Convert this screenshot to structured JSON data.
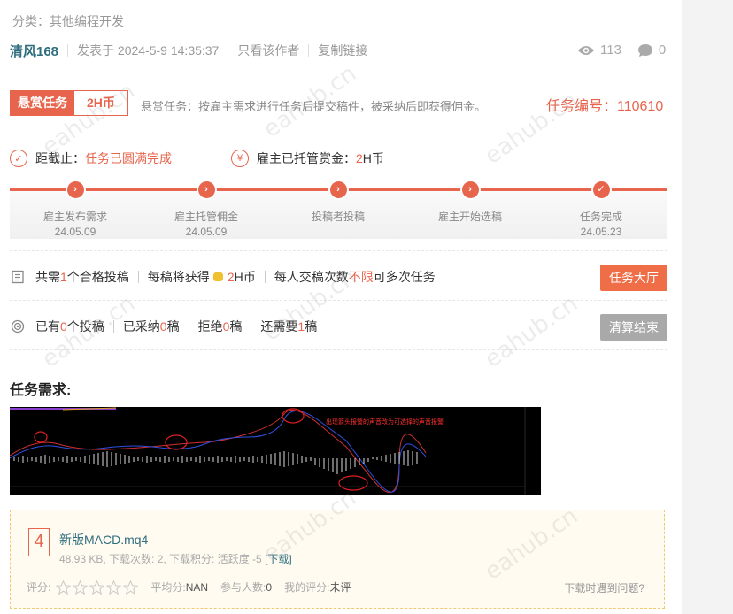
{
  "category": "分类：其他编程开发",
  "meta": {
    "author": "清风168",
    "posted": "发表于 2024-5-9 14:35:37",
    "only_author": "只看该作者",
    "copy_link": "复制链接",
    "views": "113",
    "replies": "0"
  },
  "bounty": {
    "tag": "悬赏任务",
    "amount": "2H币",
    "desc": "悬赏任务：按雇主需求进行任务后提交稿件，被采纳后即获得佣金。",
    "task_no_label": "任务编号：",
    "task_no": "110610"
  },
  "status": {
    "deadline_label": "距截止：",
    "deadline_value": "任务已圆满完成",
    "hosted_label": "雇主已托管赏金：",
    "hosted_amount": "2",
    "hosted_unit": " H币",
    "deadline_icon": "check-circle-icon",
    "hosted_icon": "yuan-icon"
  },
  "steps": [
    {
      "label": "雇主发布需求",
      "date": "24.05.09"
    },
    {
      "label": "雇主托管佣金",
      "date": "24.05.09"
    },
    {
      "label": "投稿者投稿",
      "date": ""
    },
    {
      "label": "雇主开始选稿",
      "date": ""
    },
    {
      "label": "任务完成",
      "date": "24.05.23"
    }
  ],
  "requirements": {
    "need_pre": "共需 ",
    "need_num": "1",
    "need_post": "个合格投稿",
    "earn_pre": "每稿将获得",
    "earn_num": "2",
    "earn_post": " H币",
    "times_pre": "每人交稿次数 ",
    "times_val": "不限",
    "times_post": " 可多次任务",
    "hall_button": "任务大厅"
  },
  "submissions": {
    "have_pre": "已有 ",
    "have_num": "0",
    "have_post": " 个投稿",
    "adopted_pre": "已采纳 ",
    "adopted_num": "0",
    "adopted_post": " 稿",
    "rejected_pre": "拒绝 ",
    "rejected_num": "0",
    "rejected_post": " 稿",
    "need_pre": "还需要 ",
    "need_num": "1",
    "need_post": " 稿",
    "settle_button": "清算结束"
  },
  "req_title": "任务需求:",
  "chart_annotation": "出现箭头报警的声音改为可选择的声音报警",
  "attachment": {
    "icon_digit": "4",
    "filename": "新版MACD.mq4",
    "info": "48.93 KB, 下载次数: 2, 下载积分: 活跃度 -5",
    "download": "[下载]",
    "rating_label": "评分:",
    "avg_label": "平均分: ",
    "avg": "NAN",
    "people_label": "参与人数: ",
    "people": "0",
    "my_label": "我的评分: ",
    "my": "未评",
    "help": "下载时遇到问题?",
    "star_count": 5
  },
  "watermark": "eahub.cn",
  "colors": {
    "accent": "#e8654d",
    "link": "#2e6e7e"
  }
}
